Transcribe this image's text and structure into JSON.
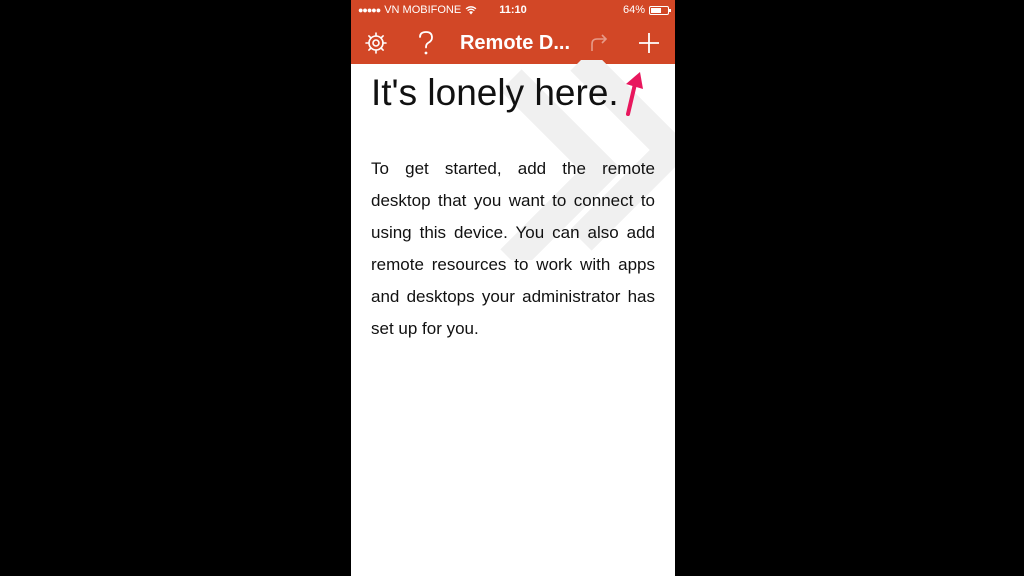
{
  "status_bar": {
    "carrier": "VN MOBIFONE",
    "time": "11:10",
    "battery": "64%",
    "battery_level": 0.64
  },
  "nav_bar": {
    "title": "Remote D...",
    "settings_icon": "gear-icon",
    "help_icon": "question-icon",
    "refresh_icon": "refresh-icon",
    "add_icon": "plus-icon"
  },
  "empty_state": {
    "heading": "It's lonely here.",
    "message": "To get started, add the remote desktop that you want to connect to using this device. You can also add remote resources to work with apps and desktops your administrator has set up for you."
  },
  "colors": {
    "accent": "#d24726",
    "annotation_arrow": "#e8175d"
  }
}
